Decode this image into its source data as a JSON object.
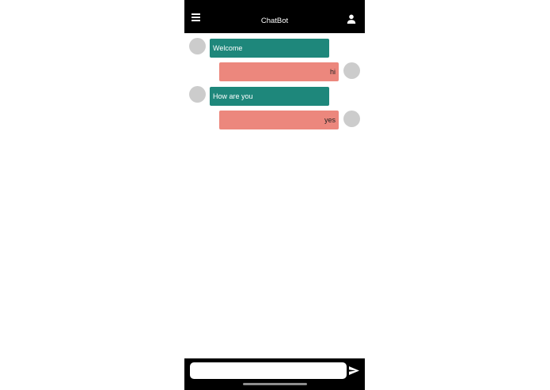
{
  "header": {
    "title": "ChatBot",
    "menu_icon": "menu-icon",
    "profile_icon": "person-icon"
  },
  "messages": [
    {
      "sender": "bot",
      "text": "Welcome"
    },
    {
      "sender": "user",
      "text": "hi"
    },
    {
      "sender": "bot",
      "text": "How are you"
    },
    {
      "sender": "user",
      "text": "yes"
    }
  ],
  "composer": {
    "value": "",
    "placeholder": "",
    "send_icon": "send-icon"
  },
  "colors": {
    "bar": "#000000",
    "bot_bubble": "#1e877b",
    "user_bubble": "#ec877d",
    "avatar": "#cccccc"
  }
}
